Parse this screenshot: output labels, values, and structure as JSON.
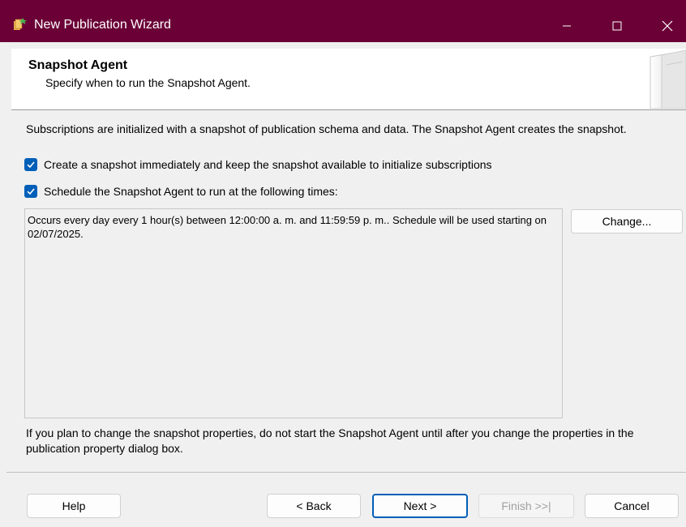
{
  "window": {
    "title": "New Publication Wizard",
    "accent_color": "#6b0036"
  },
  "header": {
    "title": "Snapshot Agent",
    "subtitle": "Specify when to run the Snapshot Agent."
  },
  "intro_text": "Subscriptions are initialized with a snapshot of publication schema and data. The Snapshot Agent creates the snapshot.",
  "options": [
    {
      "label": "Create a snapshot immediately and keep the snapshot available to initialize subscriptions",
      "checked": true
    },
    {
      "label": "Schedule the Snapshot Agent to run at the following times:",
      "checked": true
    }
  ],
  "schedule": {
    "description": "Occurs every day every 1 hour(s) between 12:00:00 a. m. and 11:59:59 p. m.. Schedule will be used starting on 02/07/2025.",
    "change_label": "Change..."
  },
  "note_text": "If you plan to change the snapshot properties, do not start the Snapshot Agent until after you change the properties in the publication property dialog box.",
  "buttons": {
    "help": "Help",
    "back": "< Back",
    "next": "Next >",
    "finish": "Finish >>|",
    "cancel": "Cancel"
  }
}
